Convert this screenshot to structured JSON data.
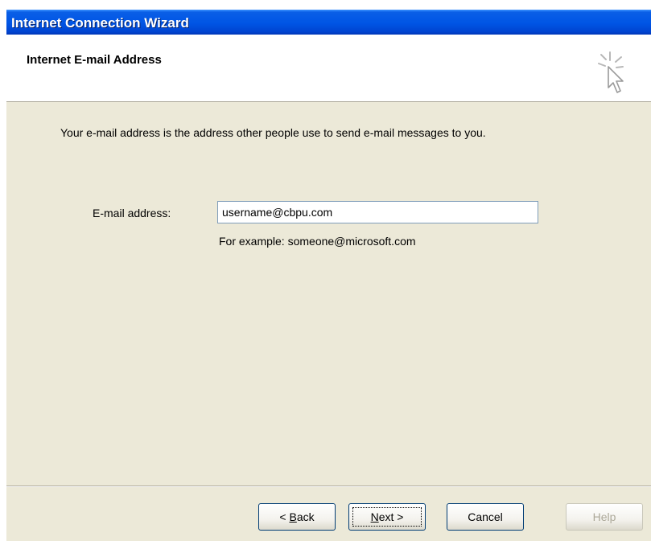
{
  "window": {
    "title": "Internet Connection Wizard"
  },
  "header": {
    "title": "Internet E-mail Address",
    "icon": "wizard-cursor-icon"
  },
  "intro_text": "Your e-mail address is the address other people use to send e-mail messages to you.",
  "email": {
    "label_mnemonic": "E",
    "label_rest": "-mail address:",
    "value": "username@cbpu.com",
    "example": "For example: someone@microsoft.com"
  },
  "buttons": {
    "back_prefix": "< ",
    "back_mnemonic": "B",
    "back_rest": "ack",
    "next_mnemonic": "N",
    "next_rest": "ext >",
    "cancel": "Cancel",
    "help": "Help"
  }
}
